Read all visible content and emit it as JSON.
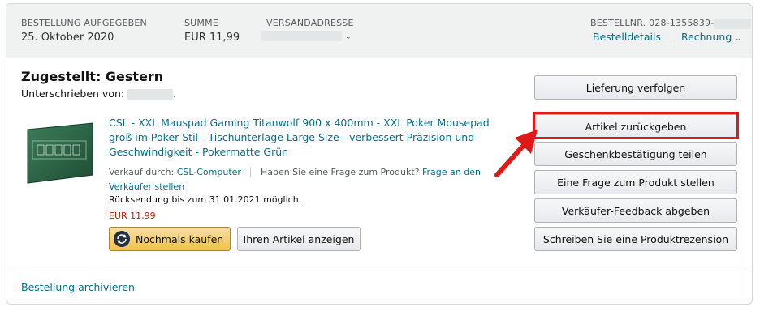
{
  "header": {
    "order_placed_label": "BESTELLUNG AUFGEGEBEN",
    "order_placed_value": "25. Oktober 2020",
    "total_label": "SUMME",
    "total_value": "EUR 11,99",
    "ship_to_label": "VERSANDADRESSE",
    "order_number_label": "BESTELLNR. 028-1355839-",
    "order_details_link": "Bestelldetails",
    "invoice_link": "Rechnung"
  },
  "shipment": {
    "status": "Zugestellt: Gestern",
    "signed_by_label": "Unterschrieben von:",
    "signed_by_suffix": "."
  },
  "item": {
    "title": "CSL - XXL Mauspad Gaming Titanwolf 900 x 400mm - XXL Poker Mousepad groß im Poker Stil - Tischunterlage Large Size - verbessert Präzision und Geschwindigkeit - Pokermatte Grün",
    "sold_by_label": "Verkauf durch:",
    "sold_by_link": "CSL-Computer",
    "question_text": "Haben Sie eine Frage zum Produkt?",
    "question_link": "Frage an den Verkäufer stellen",
    "return_text": "Rücksendung bis zum 31.01.2021 möglich.",
    "price": "EUR 11,99",
    "colors": {
      "mat": "#2f6a4a",
      "mat_dark": "#1f4d35",
      "price": "#b12704",
      "link": "#007185"
    }
  },
  "item_buttons": {
    "buy_again": "Nochmals kaufen",
    "view_item": "Ihren Artikel anzeigen"
  },
  "actions": [
    "Lieferung verfolgen",
    "Artikel zurückgeben",
    "Geschenkbestätigung teilen",
    "Eine Frage zum Produkt stellen",
    "Verkäufer-Feedback abgeben",
    "Schreiben Sie eine Produktrezension"
  ],
  "annotation": {
    "highlight_color": "#e01818",
    "highlighted_action": "Artikel zurückgeben"
  },
  "footer": {
    "archive_link": "Bestellung archivieren"
  }
}
